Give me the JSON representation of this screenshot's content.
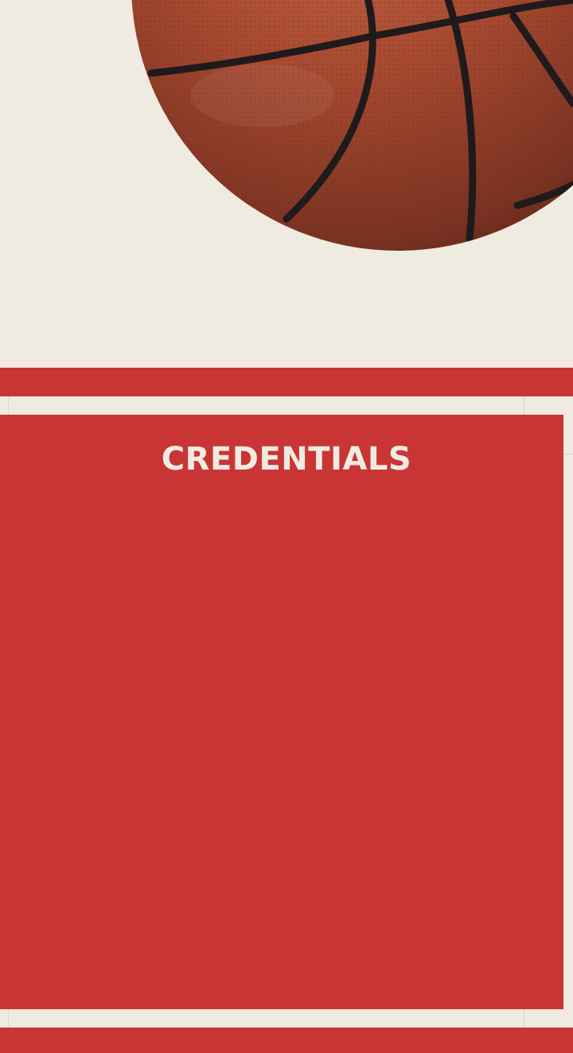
{
  "hero": {
    "image": "basketball-photo",
    "background_color": "#f0ebe1"
  },
  "section": {
    "title": "CREDENTIALS",
    "background_color": "#c93535",
    "text_color": "#f0ebe1"
  }
}
